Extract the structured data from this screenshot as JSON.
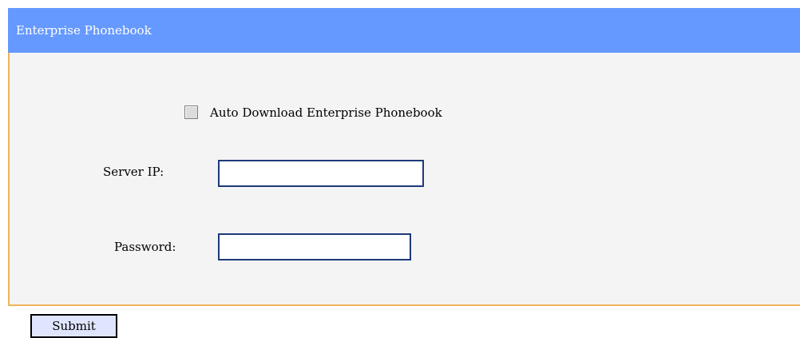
{
  "panel": {
    "title": "Enterprise Phonebook",
    "header_color": "#6699ff",
    "border_color": "#f0b45c"
  },
  "form": {
    "auto_download": {
      "label": "Auto Download Enterprise Phonebook",
      "checked": false
    },
    "server_ip": {
      "label": "Server IP:",
      "value": "",
      "placeholder": ""
    },
    "password": {
      "label": "Password:",
      "value": "",
      "placeholder": ""
    }
  },
  "actions": {
    "submit_label": "Submit"
  }
}
